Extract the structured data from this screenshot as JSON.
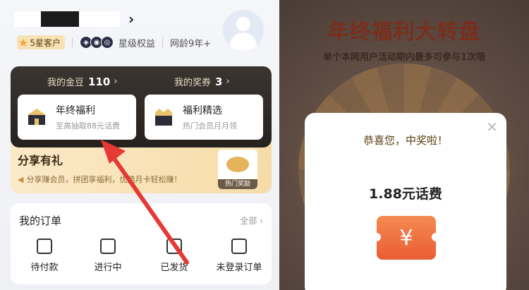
{
  "profile": {
    "star_badge": "5星客户",
    "star_rights": "星级权益",
    "network_age": "网龄9年+"
  },
  "card": {
    "beans_label": "我的金豆",
    "beans_value": "110",
    "coupons_label": "我的奖券",
    "coupons_value": "3",
    "tile1_title": "年终福利",
    "tile1_sub": "至高抽取88元话费",
    "tile2_title": "福利精选",
    "tile2_sub": "热门会员月月领"
  },
  "share": {
    "title": "分享有礼",
    "subtitle": "分享赚会员，拼团享福利，优酷月卡轻松赚！",
    "hot_label": "热门奖励"
  },
  "orders": {
    "title": "我的订单",
    "all": "全部",
    "items": [
      {
        "label": "待付款"
      },
      {
        "label": "进行中"
      },
      {
        "label": "已发货"
      },
      {
        "label": "未登录订单"
      }
    ]
  },
  "lottery": {
    "title": "年终福利大转盘",
    "subtitle": "单个本网用户活动期内最多可参与1次哦",
    "congrats": "恭喜您，中奖啦！",
    "prize": "1.88元话费",
    "ticket_symbol": "¥"
  },
  "colors": {
    "arrow": "#e53935",
    "accent": "#f06a3a"
  }
}
